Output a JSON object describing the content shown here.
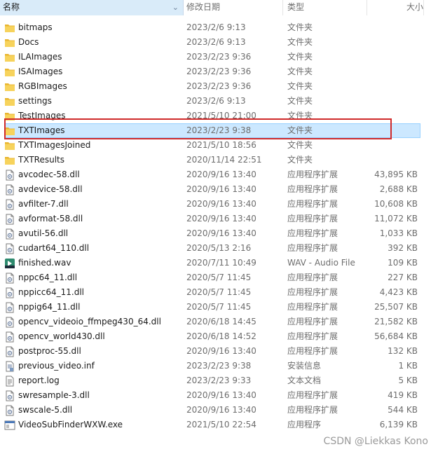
{
  "header": {
    "name": "名称",
    "date": "修改日期",
    "type": "类型",
    "size": "大小"
  },
  "files": [
    {
      "name": "bitmaps",
      "date": "2023/2/6 9:13",
      "type": "文件夹",
      "size": "",
      "icon": "folder-icon"
    },
    {
      "name": "Docs",
      "date": "2023/2/6 9:13",
      "type": "文件夹",
      "size": "",
      "icon": "folder-icon"
    },
    {
      "name": "ILAImages",
      "date": "2023/2/23 9:36",
      "type": "文件夹",
      "size": "",
      "icon": "folder-icon"
    },
    {
      "name": "ISAImages",
      "date": "2023/2/23 9:36",
      "type": "文件夹",
      "size": "",
      "icon": "folder-icon"
    },
    {
      "name": "RGBImages",
      "date": "2023/2/23 9:36",
      "type": "文件夹",
      "size": "",
      "icon": "folder-icon"
    },
    {
      "name": "settings",
      "date": "2023/2/6 9:13",
      "type": "文件夹",
      "size": "",
      "icon": "folder-icon"
    },
    {
      "name": "TestImages",
      "date": "2021/5/10 21:00",
      "type": "文件夹",
      "size": "",
      "icon": "folder-icon"
    },
    {
      "name": "TXTImages",
      "date": "2023/2/23 9:38",
      "type": "文件夹",
      "size": "",
      "icon": "folder-icon"
    },
    {
      "name": "TXTImagesJoined",
      "date": "2021/5/10 18:56",
      "type": "文件夹",
      "size": "",
      "icon": "folder-icon"
    },
    {
      "name": "TXTResults",
      "date": "2020/11/14 22:51",
      "type": "文件夹",
      "size": "",
      "icon": "folder-icon"
    },
    {
      "name": "avcodec-58.dll",
      "date": "2020/9/16 13:40",
      "type": "应用程序扩展",
      "size": "43,895 KB",
      "icon": "dll-icon"
    },
    {
      "name": "avdevice-58.dll",
      "date": "2020/9/16 13:40",
      "type": "应用程序扩展",
      "size": "2,688 KB",
      "icon": "dll-icon"
    },
    {
      "name": "avfilter-7.dll",
      "date": "2020/9/16 13:40",
      "type": "应用程序扩展",
      "size": "10,608 KB",
      "icon": "dll-icon"
    },
    {
      "name": "avformat-58.dll",
      "date": "2020/9/16 13:40",
      "type": "应用程序扩展",
      "size": "11,072 KB",
      "icon": "dll-icon"
    },
    {
      "name": "avutil-56.dll",
      "date": "2020/9/16 13:40",
      "type": "应用程序扩展",
      "size": "1,033 KB",
      "icon": "dll-icon"
    },
    {
      "name": "cudart64_110.dll",
      "date": "2020/5/13 2:16",
      "type": "应用程序扩展",
      "size": "392 KB",
      "icon": "dll-icon"
    },
    {
      "name": "finished.wav",
      "date": "2020/7/11 10:49",
      "type": "WAV - Audio File",
      "size": "109 KB",
      "icon": "wav-icon"
    },
    {
      "name": "nppc64_11.dll",
      "date": "2020/5/7 11:45",
      "type": "应用程序扩展",
      "size": "227 KB",
      "icon": "dll-icon"
    },
    {
      "name": "nppicc64_11.dll",
      "date": "2020/5/7 11:45",
      "type": "应用程序扩展",
      "size": "4,423 KB",
      "icon": "dll-icon"
    },
    {
      "name": "nppig64_11.dll",
      "date": "2020/5/7 11:45",
      "type": "应用程序扩展",
      "size": "25,507 KB",
      "icon": "dll-icon"
    },
    {
      "name": "opencv_videoio_ffmpeg430_64.dll",
      "date": "2020/6/18 14:45",
      "type": "应用程序扩展",
      "size": "21,582 KB",
      "icon": "dll-icon"
    },
    {
      "name": "opencv_world430.dll",
      "date": "2020/6/18 14:52",
      "type": "应用程序扩展",
      "size": "56,684 KB",
      "icon": "dll-icon"
    },
    {
      "name": "postproc-55.dll",
      "date": "2020/9/16 13:40",
      "type": "应用程序扩展",
      "size": "132 KB",
      "icon": "dll-icon"
    },
    {
      "name": "previous_video.inf",
      "date": "2023/2/23 9:38",
      "type": "安装信息",
      "size": "1 KB",
      "icon": "inf-icon"
    },
    {
      "name": "report.log",
      "date": "2023/2/23 9:33",
      "type": "文本文档",
      "size": "5 KB",
      "icon": "text-file-icon"
    },
    {
      "name": "swresample-3.dll",
      "date": "2020/9/16 13:40",
      "type": "应用程序扩展",
      "size": "419 KB",
      "icon": "dll-icon"
    },
    {
      "name": "swscale-5.dll",
      "date": "2020/9/16 13:40",
      "type": "应用程序扩展",
      "size": "544 KB",
      "icon": "dll-icon"
    },
    {
      "name": "VideoSubFinderWXW.exe",
      "date": "2021/5/10 22:54",
      "type": "应用程序",
      "size": "6,139 KB",
      "icon": "exe-icon"
    }
  ],
  "selected_index": 7,
  "watermark": "CSDN @Liekkas Kono",
  "colors": {
    "selection": "#cce8ff",
    "highlight_box": "#d02a2a",
    "folder": "#f5c542"
  }
}
